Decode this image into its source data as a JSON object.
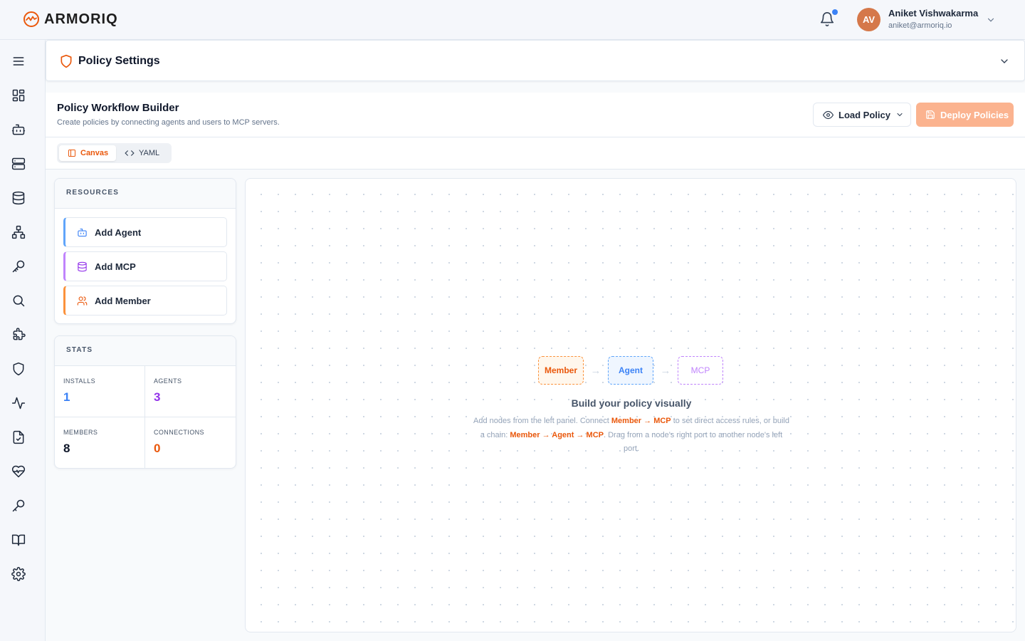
{
  "brand": {
    "name": "ARMORIQ"
  },
  "user": {
    "initials": "AV",
    "name": "Aniket Vishwakarma",
    "email": "aniket@armoriq.io"
  },
  "sidebar": {
    "items": [
      {
        "icon": "menu-icon"
      },
      {
        "icon": "dashboard-icon"
      },
      {
        "icon": "bot-icon"
      },
      {
        "icon": "server-icon"
      },
      {
        "icon": "database-icon"
      },
      {
        "icon": "network-icon"
      },
      {
        "icon": "key-icon"
      },
      {
        "icon": "search-icon"
      },
      {
        "icon": "puzzle-icon"
      },
      {
        "icon": "shield-icon"
      },
      {
        "icon": "activity-icon"
      },
      {
        "icon": "file-check-icon"
      },
      {
        "icon": "heart-pulse-icon"
      },
      {
        "icon": "key-icon"
      },
      {
        "icon": "book-icon"
      },
      {
        "icon": "settings-icon"
      }
    ]
  },
  "settings": {
    "title": "Policy Settings"
  },
  "builder": {
    "title": "Policy Workflow Builder",
    "subtitle": "Create policies by connecting agents and users to MCP servers.",
    "load_label": "Load Policy",
    "deploy_label": "Deploy Policies"
  },
  "tabs": {
    "canvas": "Canvas",
    "yaml": "YAML"
  },
  "resources": {
    "heading": "RESOURCES",
    "items": [
      {
        "label": "Add Agent",
        "icon": "bot-icon"
      },
      {
        "label": "Add MCP",
        "icon": "database-icon"
      },
      {
        "label": "Add Member",
        "icon": "users-icon"
      }
    ]
  },
  "stats": {
    "heading": "STATS",
    "items": [
      {
        "label": "INSTALLS",
        "value": "1",
        "color": "#3b82f6"
      },
      {
        "label": "AGENTS",
        "value": "3",
        "color": "#9333ea"
      },
      {
        "label": "MEMBERS",
        "value": "8",
        "color": "#0f172a"
      },
      {
        "label": "CONNECTIONS",
        "value": "0",
        "color": "#ea580c"
      }
    ]
  },
  "canvas": {
    "nodes": [
      "Member",
      "Agent",
      "MCP"
    ],
    "arrow": "→",
    "title": "Build your policy visually",
    "desc": {
      "p1": "Add nodes from the left panel. Connect ",
      "member": "Member",
      "arrow": " → ",
      "mcp": "MCP",
      "p2": " to set direct access rules, or build a chain: ",
      "agent": "Agent",
      "p3": ". Drag from a node's right port to another node's left port."
    }
  },
  "colors": {
    "accent": "#ea580c",
    "deploy": "#fbb38f"
  }
}
